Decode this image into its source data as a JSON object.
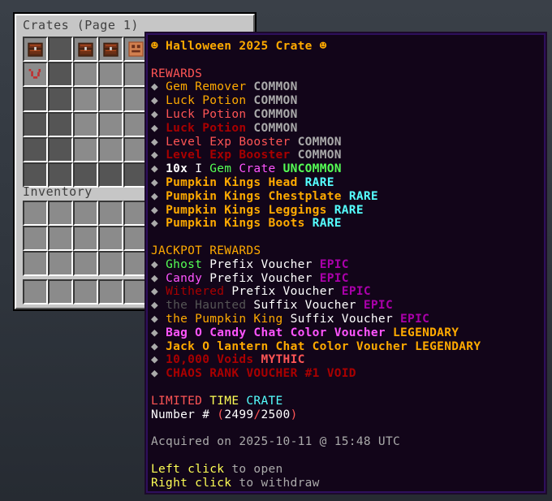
{
  "gui": {
    "title": "Crates (Page 1)",
    "inventory_label": "Inventory"
  },
  "tooltip": {
    "lines": [
      [
        {
          "t": "☻ Halloween 2025 Crate ☻",
          "c": "c-gold"
        }
      ],
      [],
      [
        {
          "t": "REWARDS",
          "c": "c-red thin"
        }
      ],
      [
        {
          "t": "◆ ",
          "c": "c-gray thin"
        },
        {
          "t": "Gem Remover ",
          "c": "c-gold thin"
        },
        {
          "t": "COMMON",
          "c": "c-gray"
        }
      ],
      [
        {
          "t": "◆ ",
          "c": "c-gray thin"
        },
        {
          "t": "Luck Potion ",
          "c": "c-gold thin"
        },
        {
          "t": "COMMON",
          "c": "c-gray"
        }
      ],
      [
        {
          "t": "◆ ",
          "c": "c-gray thin"
        },
        {
          "t": "Luck Potion ",
          "c": "c-red thin"
        },
        {
          "t": "COMMON",
          "c": "c-gray"
        }
      ],
      [
        {
          "t": "◆ ",
          "c": "c-gray thin"
        },
        {
          "t": "Luck Potion ",
          "c": "c-dred"
        },
        {
          "t": "COMMON",
          "c": "c-gray"
        }
      ],
      [
        {
          "t": "◆ ",
          "c": "c-gray thin"
        },
        {
          "t": "Level Exp Booster ",
          "c": "c-red thin"
        },
        {
          "t": "COMMON",
          "c": "c-gray"
        }
      ],
      [
        {
          "t": "◆ ",
          "c": "c-gray thin"
        },
        {
          "t": "Level Exp Booster ",
          "c": "c-dred"
        },
        {
          "t": "COMMON",
          "c": "c-gray"
        }
      ],
      [
        {
          "t": "◆ ",
          "c": "c-gray thin"
        },
        {
          "t": "10x ",
          "c": "c-white"
        },
        {
          "t": "I ",
          "c": "c-white thin"
        },
        {
          "t": "Gem ",
          "c": "c-green thin"
        },
        {
          "t": "Crate ",
          "c": "c-lpurple thin"
        },
        {
          "t": "UNCOMMON",
          "c": "c-green"
        }
      ],
      [
        {
          "t": "◆ ",
          "c": "c-gray thin"
        },
        {
          "t": "Pumpkin Kings Head ",
          "c": "c-gold"
        },
        {
          "t": "RARE",
          "c": "c-aqua"
        }
      ],
      [
        {
          "t": "◆ ",
          "c": "c-gray thin"
        },
        {
          "t": "Pumpkin Kings Chestplate ",
          "c": "c-gold"
        },
        {
          "t": "RARE",
          "c": "c-aqua"
        }
      ],
      [
        {
          "t": "◆ ",
          "c": "c-gray thin"
        },
        {
          "t": "Pumpkin Kings Leggings ",
          "c": "c-gold"
        },
        {
          "t": "RARE",
          "c": "c-aqua"
        }
      ],
      [
        {
          "t": "◆ ",
          "c": "c-gray thin"
        },
        {
          "t": "Pumpkin Kings Boots ",
          "c": "c-gold"
        },
        {
          "t": "RARE",
          "c": "c-aqua"
        }
      ],
      [],
      [
        {
          "t": "JACKPOT REWARDS",
          "c": "c-gold thin"
        }
      ],
      [
        {
          "t": "◆ ",
          "c": "c-gray thin"
        },
        {
          "t": "Ghost ",
          "c": "c-green thin"
        },
        {
          "t": "Prefix Voucher ",
          "c": "c-white thin"
        },
        {
          "t": "EPIC",
          "c": "c-purple"
        }
      ],
      [
        {
          "t": "◆ ",
          "c": "c-gray thin"
        },
        {
          "t": "Candy ",
          "c": "c-lpurple thin"
        },
        {
          "t": "Prefix Voucher ",
          "c": "c-white thin"
        },
        {
          "t": "EPIC",
          "c": "c-purple"
        }
      ],
      [
        {
          "t": "◆ ",
          "c": "c-gray thin"
        },
        {
          "t": "Withered ",
          "c": "c-dred thin"
        },
        {
          "t": "Prefix Voucher ",
          "c": "c-white thin"
        },
        {
          "t": "EPIC",
          "c": "c-purple"
        }
      ],
      [
        {
          "t": "◆ ",
          "c": "c-gray thin"
        },
        {
          "t": "the Haunted ",
          "c": "c-dgray thin"
        },
        {
          "t": "Suffix Voucher ",
          "c": "c-white thin"
        },
        {
          "t": "EPIC",
          "c": "c-purple"
        }
      ],
      [
        {
          "t": "◆ ",
          "c": "c-gray thin"
        },
        {
          "t": "the Pumpkin King ",
          "c": "c-gold thin"
        },
        {
          "t": "Suffix Voucher ",
          "c": "c-white thin"
        },
        {
          "t": "EPIC",
          "c": "c-purple"
        }
      ],
      [
        {
          "t": "◆ ",
          "c": "c-gray thin"
        },
        {
          "t": "Bag O Candy Chat Color Voucher ",
          "c": "c-lpurple"
        },
        {
          "t": "LEGENDARY",
          "c": "c-gold"
        }
      ],
      [
        {
          "t": "◆ ",
          "c": "c-gray thin"
        },
        {
          "t": "Jack O lantern Chat Color Voucher ",
          "c": "c-gold"
        },
        {
          "t": "LEGENDARY",
          "c": "c-gold"
        }
      ],
      [
        {
          "t": "◆ ",
          "c": "c-gray thin"
        },
        {
          "t": "10,000 Voids ",
          "c": "c-dred"
        },
        {
          "t": "MYTHIC",
          "c": "c-red"
        }
      ],
      [
        {
          "t": "◆ ",
          "c": "c-gray thin"
        },
        {
          "t": "CHAOS RANK VOUCHER #1 ",
          "c": "c-dred"
        },
        {
          "t": "VOID",
          "c": "c-dred"
        }
      ],
      [],
      [
        {
          "t": "LIMITED ",
          "c": "c-red thin"
        },
        {
          "t": "TIME ",
          "c": "c-yellow thin"
        },
        {
          "t": "CRATE",
          "c": "c-aqua thin"
        }
      ],
      [
        {
          "t": "Number # ",
          "c": "c-white thin"
        },
        {
          "t": "(",
          "c": "c-red thin"
        },
        {
          "t": "2499",
          "c": "c-white thin"
        },
        {
          "t": "/",
          "c": "c-red thin"
        },
        {
          "t": "2500",
          "c": "c-white thin"
        },
        {
          "t": ")",
          "c": "c-red thin"
        }
      ],
      [],
      [
        {
          "t": "Acquired on 2025-10-11 @ 15:48 UTC",
          "c": "c-gray thin"
        }
      ],
      [],
      [
        {
          "t": "Left click ",
          "c": "c-yellow thin"
        },
        {
          "t": "to open",
          "c": "c-gray thin"
        }
      ],
      [
        {
          "t": "Right click ",
          "c": "c-yellow thin"
        },
        {
          "t": "to withdraw",
          "c": "c-gray thin"
        }
      ]
    ]
  }
}
